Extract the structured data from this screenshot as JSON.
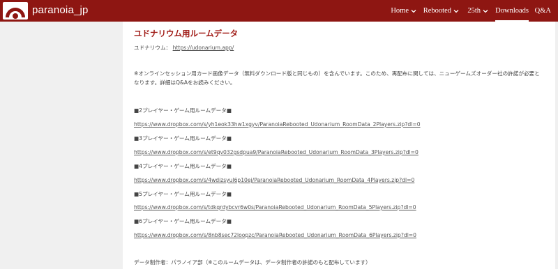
{
  "header": {
    "site_name": "paranoia_jp",
    "nav": [
      {
        "label": "Home",
        "has_dropdown": true
      },
      {
        "label": "Rebooted",
        "has_dropdown": true
      },
      {
        "label": "25th",
        "has_dropdown": true
      },
      {
        "label": "Downloads",
        "has_dropdown": false,
        "active": true
      },
      {
        "label": "Q&A",
        "has_dropdown": false
      }
    ]
  },
  "main": {
    "title": "ユドナリウム用ルームデータ",
    "udonarium_label": "ユドナリウム：",
    "udonarium_link": "https://udonarium.app/",
    "note_line1": "※オンラインセッション用カード画像データ（無料ダウンロード版と同じもの）を含んでいます。このため、再配布に関しては、ニューゲームズオーダー社の許諾が必要と",
    "note_line2": "なります。詳細はQ&Aをお読みください。",
    "downloads": [
      {
        "heading": "■2プレイヤー・ゲーム用ルームデータ■",
        "url": "https://www.dropbox.com/s/yh1eok33hw1xgyv/ParanoiaRebooted_Udonarium_RoomData_2Players.zip?dl=0"
      },
      {
        "heading": "■3プレイヤー・ゲーム用ルームデータ■",
        "url": "https://www.dropbox.com/s/et9qv032gsdpua9/ParanoiaRebooted_Udonarium_RoomData_3Players.zip?dl=0"
      },
      {
        "heading": "■4プレイヤー・ゲーム用ルームデータ■",
        "url": "https://www.dropbox.com/s/4wdizsyul6p10ej/ParanoiaRebooted_Udonarium_RoomData_4Players.zip?dl=0"
      },
      {
        "heading": "■5プレイヤー・ゲーム用ルームデータ■",
        "url": "https://www.dropbox.com/s/tdkqrdybcvr6w0s/ParanoiaRebooted_Udonarium_RoomData_5Players.zip?dl=0"
      },
      {
        "heading": "■6プレイヤー・ゲーム用ルームデータ■",
        "url": "https://www.dropbox.com/s/8nb8sec72loopzc/ParanoiaRebooted_Udonarium_RoomData_6Players.zip?dl=0"
      }
    ],
    "credit": "データ制作者：パラノイア部（※このルームデータは、データ制作者の許諾のもと配布しています）"
  },
  "colors": {
    "header_bg": "#8e1612",
    "title": "#a01b16",
    "page_bg": "#f0f0f0",
    "content_bg": "#ffffff"
  },
  "icons": {
    "logo": "paranoia-computer-eye-logo",
    "dropdown": "chevron-down-icon"
  }
}
